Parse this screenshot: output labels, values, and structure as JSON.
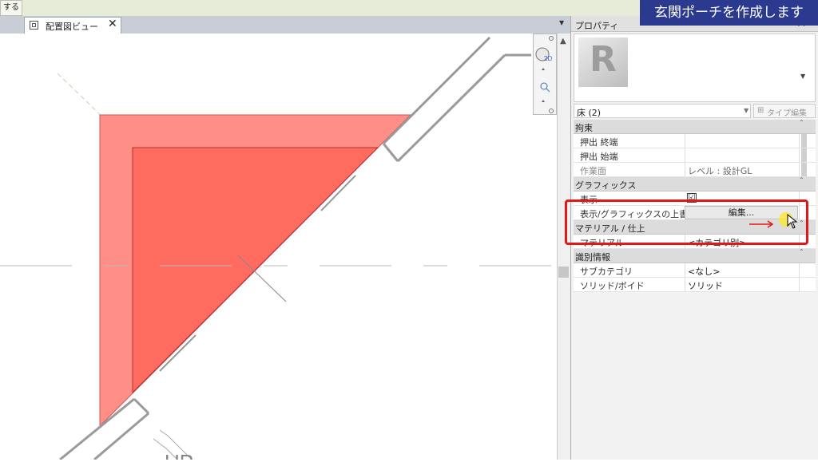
{
  "toolbar": {
    "fragment_label": "する"
  },
  "view_tab": {
    "label": "配置図ビュー",
    "close": "✕",
    "menu_arrow": "▼"
  },
  "properties": {
    "title": "プロパティ",
    "close": "✕",
    "type_logo": "R",
    "instance_label": "床 (2)",
    "edit_type_icon": "⊞",
    "edit_type_label": "タイプ編集",
    "groups": {
      "constraints": "拘束",
      "graphics": "グラフィックス",
      "materials": "マテリアル / 仕上",
      "identity": "識別情報"
    },
    "rows": {
      "extrusion_end": {
        "name": "押出 終端",
        "value": ""
      },
      "extrusion_start": {
        "name": "押出 始端",
        "value": ""
      },
      "work_plane": {
        "name": "作業面",
        "value": "レベル : 設計GL"
      },
      "visible": {
        "name": "表示",
        "checked": "☑"
      },
      "vg_override": {
        "name": "表示/グラフィックスの上書き",
        "button": "編集..."
      },
      "material": {
        "name": "マテリアル",
        "value": "<カテゴリ別>"
      },
      "subcategory": {
        "name": "サブカテゴリ",
        "value": "<なし>"
      },
      "solid_void": {
        "name": "ソリッド/ボイド",
        "value": "ソリッド"
      }
    }
  },
  "canvas": {
    "text_fragment": "UP"
  },
  "caption": {
    "text": "玄関ポーチを作成します"
  },
  "colors": {
    "floor_fill": "#ff6b5e",
    "floor_outer": "#ff8f86",
    "highlight": "#e01818",
    "caption_bg": "#2b3a8f"
  }
}
